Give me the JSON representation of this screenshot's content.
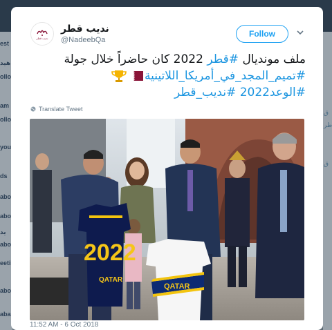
{
  "background": {
    "left_fragments": [
      "est",
      "هید",
      "ollo",
      "am",
      "ollo",
      "you",
      "ds",
      "abo",
      "abo",
      "يد",
      "abo",
      "eetin",
      "abo",
      "aba"
    ],
    "right_fragments": [
      "ق",
      "ظر",
      "ق"
    ]
  },
  "tweet": {
    "avatar_text": "نديب قطر",
    "display_name": "نديب قطر",
    "handle": "@NadeebQa",
    "follow_label": "Follow",
    "line1_plain": "ملف مونديال ",
    "line1_tag": "#قطر",
    "line1_rest": " 2022 كان حاضراً خلال جولة",
    "line2_tag": "#تميم_المجد_في_أمريكا_اللاتينية",
    "line3_tags": "#الوعد2022 #نديب_قطر",
    "translate_label": "Translate Tweet",
    "timestamp": "11:52 AM - 6 Oct 2018",
    "photo": {
      "jersey_left_text": "2022",
      "jersey_left_name": "QATAR",
      "jersey_right_text": "QATAR"
    }
  },
  "colors": {
    "link": "#1b95e0",
    "follow": "#1da1f2",
    "qatar_maroon": "#8a1538"
  },
  "icons": [
    "chevron-down-icon",
    "trophy-icon",
    "qatar-flag-icon",
    "globe-icon"
  ]
}
